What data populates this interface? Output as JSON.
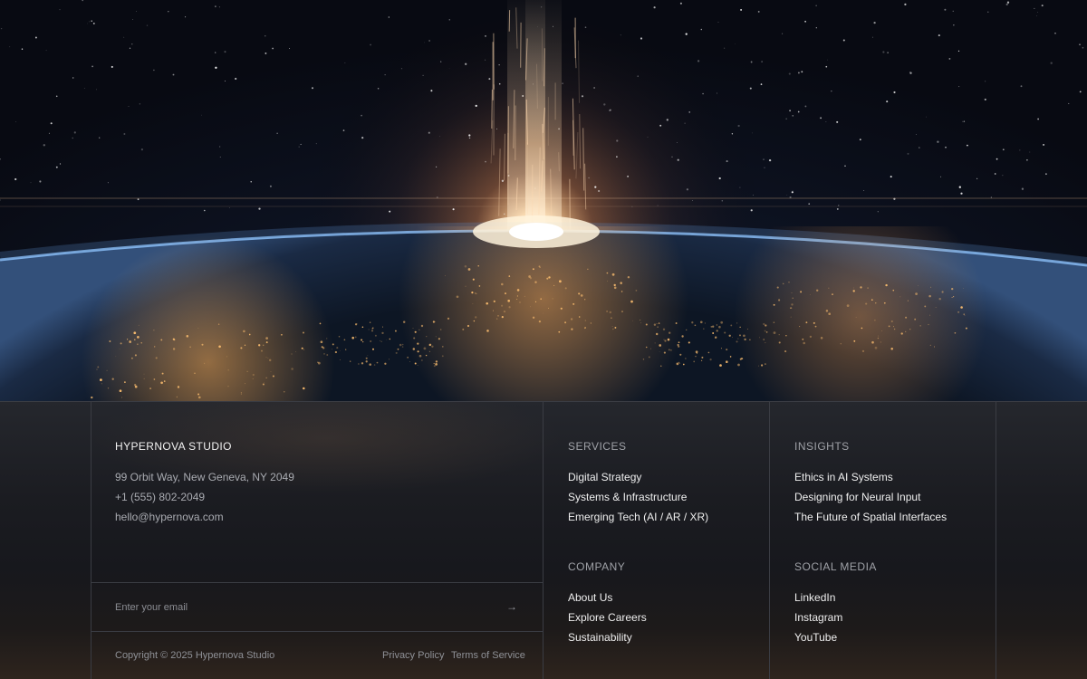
{
  "brand": {
    "name": "HYPERNOVA STUDIO",
    "address": "99 Orbit Way, New Geneva, NY 2049",
    "phone": "+1 (555) 802-2049",
    "email": "hello@hypernova.com"
  },
  "newsletter": {
    "placeholder": "Enter your email",
    "submit_icon": "→"
  },
  "legal": {
    "copyright": "Copyright © 2025 Hypernova Studio",
    "privacy": "Privacy Policy",
    "terms": "Terms of Service"
  },
  "services": {
    "heading": "SERVICES",
    "links": [
      "Digital Strategy",
      "Systems & Infrastructure",
      "Emerging Tech (AI / AR / XR)"
    ]
  },
  "insights": {
    "heading": "INSIGHTS",
    "links": [
      "Ethics in AI Systems",
      "Designing for Neural Input",
      "The Future of Spatial Interfaces"
    ]
  },
  "company": {
    "heading": "COMPANY",
    "links": [
      "About Us",
      "Explore Careers",
      "Sustainability"
    ]
  },
  "social": {
    "heading": "SOCIAL MEDIA",
    "links": [
      "LinkedIn",
      "Instagram",
      "YouTube"
    ]
  },
  "colors": {
    "footer_bg": "#17181c",
    "divider": "#3a3c43",
    "text_primary": "#eeeeee",
    "text_muted": "#a9abb1",
    "glow": "#ffb066"
  }
}
